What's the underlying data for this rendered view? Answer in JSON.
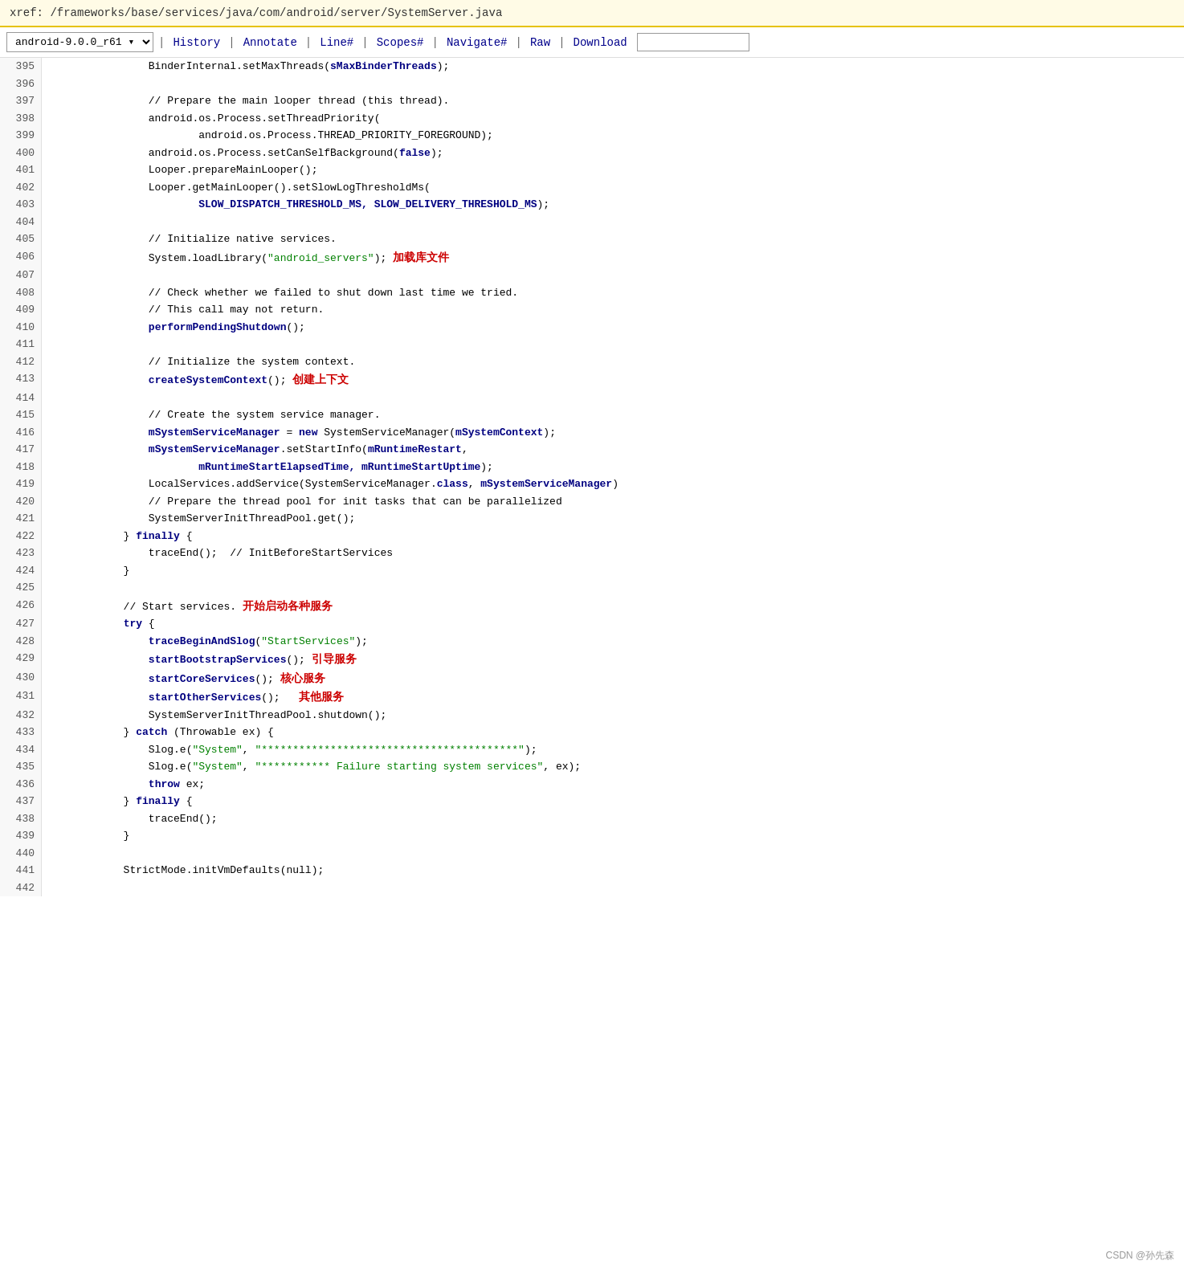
{
  "title_bar": {
    "text": "xref: /frameworks/base/services/java/com/android/server/SystemServer.java"
  },
  "nav": {
    "version_label": "android-9.0.0_r61",
    "separator": "|",
    "links": [
      "History",
      "Annotate",
      "Line#",
      "Scopes#",
      "Navigate#",
      "Raw",
      "Download"
    ],
    "search_placeholder": ""
  },
  "footer": {
    "text": "CSDN @孙先森"
  },
  "code_lines": [
    {
      "num": "395",
      "content": "                BinderInternal.setMaxThreads(<bold>sMaxBinderThreads</bold>);"
    },
    {
      "num": "396",
      "content": ""
    },
    {
      "num": "397",
      "content": "                // Prepare the main looper thread (this thread)."
    },
    {
      "num": "398",
      "content": "                android.os.Process.setThreadPriority("
    },
    {
      "num": "399",
      "content": "                        android.os.Process.THREAD_PRIORITY_FOREGROUND);"
    },
    {
      "num": "400",
      "content": "                android.os.Process.setCanSelfBackground(<kw>false</kw>);"
    },
    {
      "num": "401",
      "content": "                Looper.prepareMainLooper();"
    },
    {
      "num": "402",
      "content": "                Looper.getMainLooper().setSlowLogThresholdMs("
    },
    {
      "num": "403",
      "content": "                        <bold>SLOW_DISPATCH_THRESHOLD_MS, SLOW_DELIVERY_THRESHOLD_MS</bold>);"
    },
    {
      "num": "404",
      "content": ""
    },
    {
      "num": "405",
      "content": "                // Initialize native services."
    },
    {
      "num": "406",
      "content": "                System.loadLibrary(<str>\"android_servers\"</str>); <cn>加载库文件</cn>"
    },
    {
      "num": "407",
      "content": ""
    },
    {
      "num": "408",
      "content": "                // Check whether we failed to shut down last time we tried."
    },
    {
      "num": "409",
      "content": "                // This call may not return."
    },
    {
      "num": "410",
      "content": "                <bold>performPendingShutdown</bold>();"
    },
    {
      "num": "411",
      "content": ""
    },
    {
      "num": "412",
      "content": "                // Initialize the system context."
    },
    {
      "num": "413",
      "content": "                <bold>createSystemContext</bold>(); <cn>创建上下文</cn>"
    },
    {
      "num": "414",
      "content": ""
    },
    {
      "num": "415",
      "content": "                // Create the system service manager."
    },
    {
      "num": "416",
      "content": "                <bold>mSystemServiceManager</bold> = <kw>new</kw> SystemServiceManager(<bold>mSystemContext</bold>);"
    },
    {
      "num": "417",
      "content": "                <bold>mSystemServiceManager</bold>.setStartInfo(<bold>mRuntimeRestart</bold>,"
    },
    {
      "num": "418",
      "content": "                        <bold>mRuntimeStartElapsedTime, mRuntimeStartUptime</bold>);"
    },
    {
      "num": "419",
      "content": "                LocalServices.addService(SystemServiceManager.<kw>class</kw>, <bold>mSystemServiceManager</bold>)"
    },
    {
      "num": "420",
      "content": "                // Prepare the thread pool for init tasks that can be parallelized"
    },
    {
      "num": "421",
      "content": "                SystemServerInitThreadPool.get();"
    },
    {
      "num": "422",
      "content": "            } <kw>finally</kw> {"
    },
    {
      "num": "423",
      "content": "                traceEnd();  // InitBeforeStartServices"
    },
    {
      "num": "424",
      "content": "            }"
    },
    {
      "num": "425",
      "content": ""
    },
    {
      "num": "426",
      "content": "            // Start services. <cn>开始启动各种服务</cn>"
    },
    {
      "num": "427",
      "content": "            <kw>try</kw> {"
    },
    {
      "num": "428",
      "content": "                <bold>traceBeginAndSlog</bold>(<str>\"StartServices\"</str>);"
    },
    {
      "num": "429",
      "content": "                <bold>startBootstrapServices</bold>(); <cn>引导服务</cn>"
    },
    {
      "num": "430",
      "content": "                <bold>startCoreServices</bold>(); <cn>核心服务</cn>"
    },
    {
      "num": "431",
      "content": "                <bold>startOtherServices</bold>();   <cn>其他服务</cn>"
    },
    {
      "num": "432",
      "content": "                SystemServerInitThreadPool.shutdown();"
    },
    {
      "num": "433",
      "content": "            } <kw>catch</kw> (Throwable ex) {"
    },
    {
      "num": "434",
      "content": "                Slog.e(<str>\"System\"</str>, <str>\"*****************************************\"</str>);"
    },
    {
      "num": "435",
      "content": "                Slog.e(<str>\"System\"</str>, <str>\"*********** Failure starting system services\"</str>, ex);"
    },
    {
      "num": "436",
      "content": "                <kw>throw</kw> ex;"
    },
    {
      "num": "437",
      "content": "            } <kw>finally</kw> {"
    },
    {
      "num": "438",
      "content": "                traceEnd();"
    },
    {
      "num": "439",
      "content": "            }"
    },
    {
      "num": "440",
      "content": ""
    },
    {
      "num": "441",
      "content": "            StrictMode.initVmDefaults(null);"
    },
    {
      "num": "442",
      "content": ""
    }
  ]
}
